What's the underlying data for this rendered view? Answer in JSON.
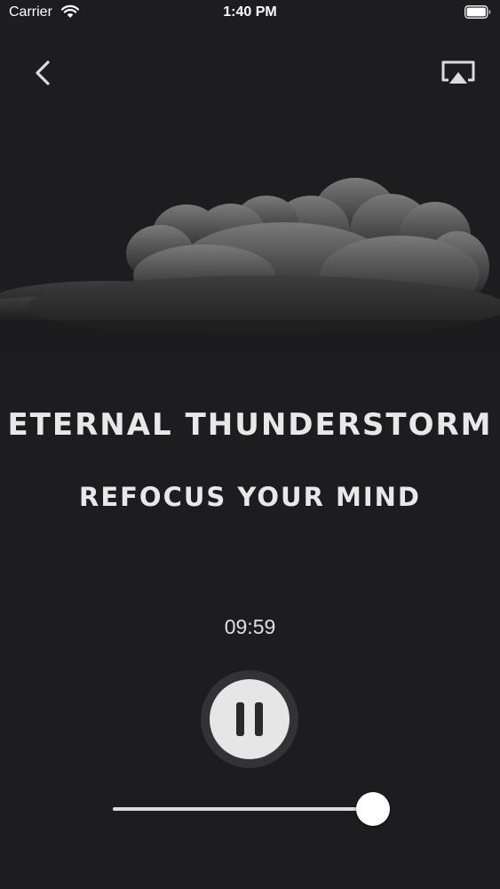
{
  "status_bar": {
    "carrier": "Carrier",
    "time": "1:40 PM",
    "icons": [
      "wifi-icon",
      "battery-icon"
    ]
  },
  "nav": {
    "back_icon": "chevron-left-icon",
    "airplay_icon": "airplay-icon"
  },
  "artwork": {
    "icon": "storm-cloud-icon"
  },
  "track": {
    "title": "ETERNAL THUNDERSTORM",
    "subtitle": "REFOCUS YOUR MIND"
  },
  "player": {
    "timer": "09:59",
    "control_icon": "pause-icon",
    "slider_value": 1.0
  },
  "colors": {
    "background": "#1d1c1e",
    "text": "#e8e8e8",
    "control_ring": "#333235",
    "control_face": "#e6e6e6",
    "slider_track": "#dddddd",
    "slider_thumb": "#ffffff"
  }
}
